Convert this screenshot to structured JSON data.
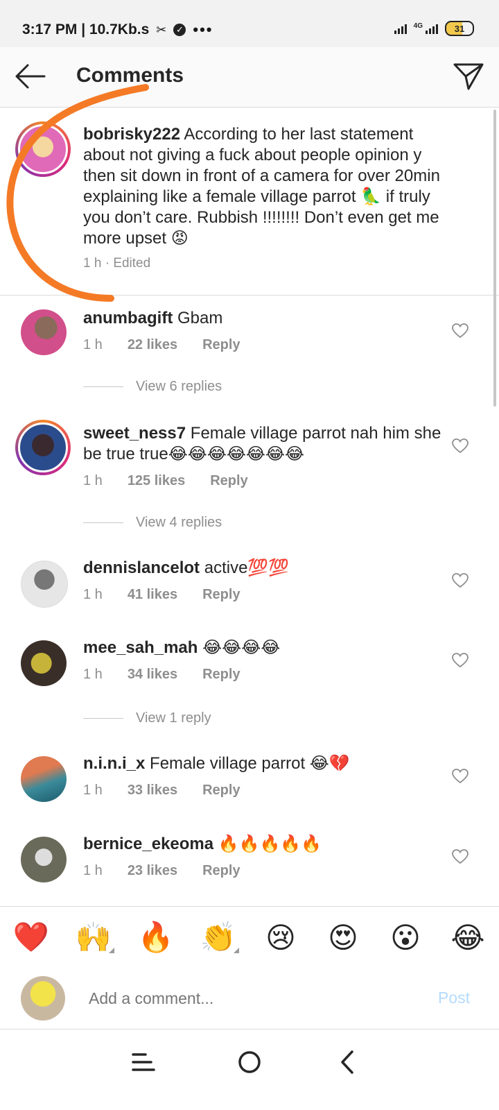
{
  "status_bar": {
    "time_speed": "3:17 PM | 10.7Kb.s",
    "network_type": "4G",
    "battery": "31"
  },
  "header": {
    "title": "Comments"
  },
  "caption": {
    "username": "bobrisky222",
    "text": " According to her last statement about not giving a fuck about people opinion y then sit down in front of a camera for over 20min explaining like a female village parrot 🦜 if truly you don’t care. Rubbish !!!!!!!! Don’t even get me more upset 😡",
    "time": "1 h",
    "edited": "Edited"
  },
  "comments": [
    {
      "username": "anumbagift",
      "text": " Gbam",
      "time": "1 h",
      "likes": "22 likes",
      "reply": "Reply"
    },
    {
      "username": "sweet_ness7",
      "text": " Female village parrot nah him she be true true😂😂😂😂😂😂😂",
      "time": "1 h",
      "likes": "125 likes",
      "reply": "Reply"
    },
    {
      "username": "dennislancelot",
      "text": " active💯💯",
      "time": "1 h",
      "likes": "41 likes",
      "reply": "Reply"
    },
    {
      "username": "mee_sah_mah",
      "text": " 😂😂😂😂",
      "time": "1 h",
      "likes": "34 likes",
      "reply": "Reply"
    },
    {
      "username": "n.i.n.i_x",
      "text": " Female village parrot 😂💔",
      "time": "1 h",
      "likes": "33 likes",
      "reply": "Reply"
    },
    {
      "username": "bernice_ekeoma",
      "text": " 🔥🔥🔥🔥🔥",
      "time": "1 h",
      "likes": "23 likes",
      "reply": "Reply"
    }
  ],
  "view_replies": [
    "View 6 replies",
    "View 4 replies",
    "View 1 reply"
  ],
  "emoji_bar": [
    "❤️",
    "🙌",
    "🔥",
    "👏",
    "😢",
    "😍",
    "😮",
    "😂"
  ],
  "compose": {
    "placeholder": "Add a comment...",
    "post_label": "Post"
  },
  "colors": {
    "marker": "#f47a26",
    "link_disabled": "#b3dbff",
    "meta_gray": "#8e8e8e"
  }
}
